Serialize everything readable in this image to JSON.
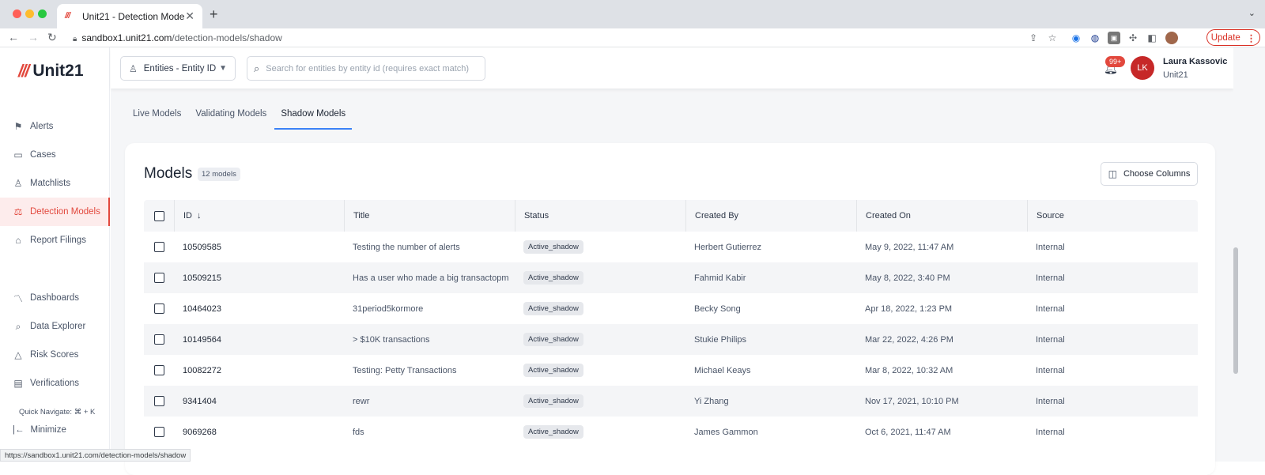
{
  "browser": {
    "tab_title": "Unit21 - Detection Model",
    "tab_close": "✕",
    "new_tab": "+",
    "url_domain": "sandbox1.unit21.com",
    "url_path": "/detection-models/shadow",
    "update_label": "Update",
    "status_url": "https://sandbox1.unit21.com/detection-models/shadow"
  },
  "app": {
    "logo_text": "Unit21",
    "entity_select": "Entities - Entity ID",
    "search_placeholder": "Search for entities by entity id (requires exact match)",
    "notification_count": "99+",
    "user": {
      "initials": "LK",
      "name": "Laura Kassovic",
      "org": "Unit21"
    }
  },
  "sidebar": {
    "items": [
      {
        "label": "Alerts",
        "icon": "flag-icon"
      },
      {
        "label": "Cases",
        "icon": "briefcase-icon"
      },
      {
        "label": "Matchlists",
        "icon": "user-x-icon"
      },
      {
        "label": "Detection Models",
        "icon": "scale-icon",
        "active": true
      },
      {
        "label": "Report Filings",
        "icon": "bank-icon"
      },
      {
        "label": "Dashboards",
        "icon": "chart-line-icon"
      },
      {
        "label": "Data Explorer",
        "icon": "search-data-icon"
      },
      {
        "label": "Risk Scores",
        "icon": "warning-icon"
      },
      {
        "label": "Verifications",
        "icon": "id-card-icon"
      }
    ],
    "quick_navigate": "Quick Navigate: ⌘ + K",
    "minimize": "Minimize"
  },
  "tabs": [
    "Live Models",
    "Validating Models",
    "Shadow Models"
  ],
  "models": {
    "title": "Models",
    "count": "12 models",
    "choose_columns": "Choose Columns",
    "columns": [
      "ID",
      "Title",
      "Status",
      "Created By",
      "Created On",
      "Source"
    ],
    "rows": [
      {
        "id": "10509585",
        "title": "Testing the number of alerts",
        "status": "Active_shadow",
        "created_by": "Herbert Gutierrez",
        "created_on": "May 9, 2022, 11:47 AM",
        "source": "Internal"
      },
      {
        "id": "10509215",
        "title": "Has a user who made a big transactopm",
        "status": "Active_shadow",
        "created_by": "Fahmid Kabir",
        "created_on": "May 8, 2022, 3:40 PM",
        "source": "Internal"
      },
      {
        "id": "10464023",
        "title": "31period5kormore",
        "status": "Active_shadow",
        "created_by": "Becky Song",
        "created_on": "Apr 18, 2022, 1:23 PM",
        "source": "Internal"
      },
      {
        "id": "10149564",
        "title": "> $10K transactions",
        "status": "Active_shadow",
        "created_by": "Stukie Philips",
        "created_on": "Mar 22, 2022, 4:26 PM",
        "source": "Internal"
      },
      {
        "id": "10082272",
        "title": "Testing: Petty Transactions",
        "status": "Active_shadow",
        "created_by": "Michael Keays",
        "created_on": "Mar 8, 2022, 10:32 AM",
        "source": "Internal"
      },
      {
        "id": "9341404",
        "title": "rewr",
        "status": "Active_shadow",
        "created_by": "Yi Zhang",
        "created_on": "Nov 17, 2021, 10:10 PM",
        "source": "Internal"
      },
      {
        "id": "9069268",
        "title": "fds",
        "status": "Active_shadow",
        "created_by": "James Gammon",
        "created_on": "Oct 6, 2021, 11:47 AM",
        "source": "Internal"
      }
    ]
  },
  "colors": {
    "brand": "#e2483d",
    "tab_underline": "#3b82f6",
    "avatar": "#c62828"
  }
}
